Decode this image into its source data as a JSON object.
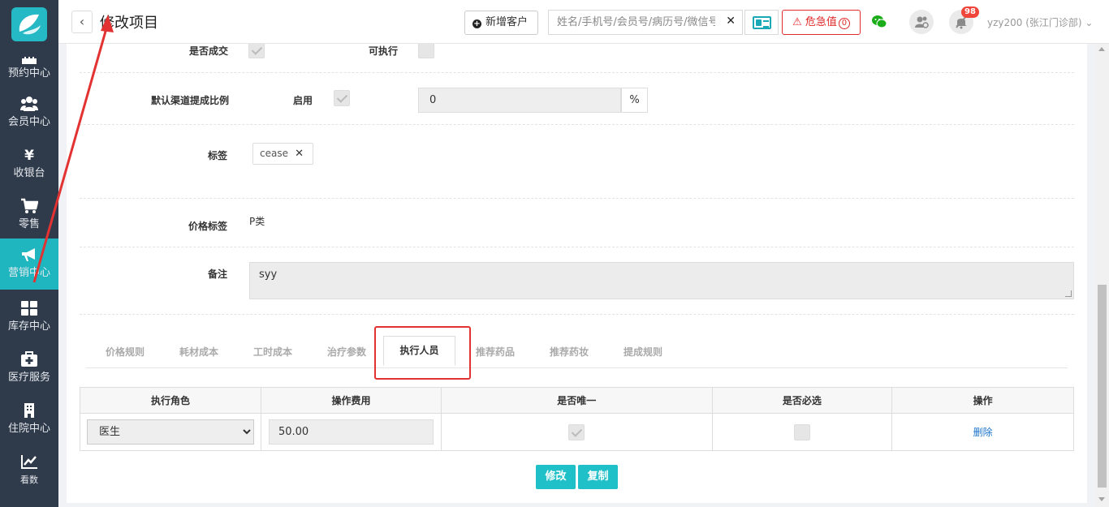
{
  "header": {
    "title": "修改项目",
    "add_customer": "新增客户",
    "search_placeholder": "姓名/手机号/会员号/病历号/微信号",
    "critical_label": "危急值",
    "critical_count": "0",
    "notification_count": "98",
    "user": "yzy200 (张江门诊部)"
  },
  "sidebar": {
    "items": [
      {
        "label": "预约中心",
        "icon": "calendar-icon"
      },
      {
        "label": "会员中心",
        "icon": "members-icon"
      },
      {
        "label": "收银台",
        "icon": "yen-icon"
      },
      {
        "label": "零售",
        "icon": "cart-icon"
      },
      {
        "label": "营销中心",
        "icon": "megaphone-icon"
      },
      {
        "label": "库存中心",
        "icon": "grid-icon"
      },
      {
        "label": "医疗服务",
        "icon": "medkit-icon"
      },
      {
        "label": "住院中心",
        "icon": "building-icon"
      },
      {
        "label": "看数",
        "icon": "chart-icon"
      }
    ]
  },
  "form": {
    "deal_label": "是否成交",
    "deal_checked": true,
    "executable_label": "可执行",
    "executable_checked": false,
    "default_ratio_label": "默认渠道提成比例",
    "enable_label": "启用",
    "enable_checked": true,
    "ratio_value": "0",
    "ratio_unit": "%",
    "tag_label": "标签",
    "tag_value": "cease",
    "price_tag_label": "价格标签",
    "price_tag_value": "P类",
    "remark_label": "备注",
    "remark_value": "syy"
  },
  "tabs": [
    "价格规则",
    "耗材成本",
    "工时成本",
    "治疗参数",
    "执行人员",
    "推荐药品",
    "推荐药妆",
    "提成规则"
  ],
  "active_tab": "执行人员",
  "table": {
    "headers": [
      "执行角色",
      "操作费用",
      "是否唯一",
      "是否必选",
      "操作"
    ],
    "rows": [
      {
        "role": "医生",
        "fee": "50.00",
        "unique": true,
        "required": false,
        "action": "删除"
      }
    ]
  },
  "buttons": {
    "modify": "修改",
    "copy": "复制"
  },
  "colors": {
    "accent": "#1fb6bf",
    "sidebar_bg": "#2f3a4a",
    "critical": "#e12b2b",
    "annotation": "#e23232"
  }
}
